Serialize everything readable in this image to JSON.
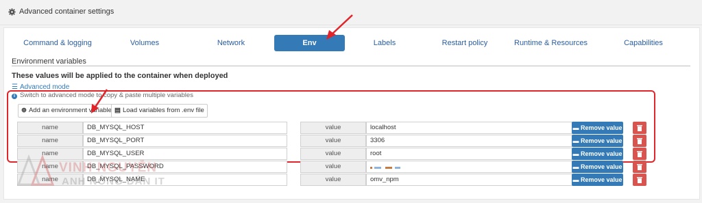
{
  "header": {
    "title": "Advanced container settings",
    "icon": "gear-icon"
  },
  "tabs": [
    {
      "label": "Command & logging",
      "active": false
    },
    {
      "label": "Volumes",
      "active": false
    },
    {
      "label": "Network",
      "active": false
    },
    {
      "label": "Env",
      "active": true
    },
    {
      "label": "Labels",
      "active": false
    },
    {
      "label": "Restart policy",
      "active": false
    },
    {
      "label": "Runtime & Resources",
      "active": false
    },
    {
      "label": "Capabilities",
      "active": false
    }
  ],
  "env": {
    "section_title": "Environment variables",
    "applied_text": "These values will be applied to the container when deployed",
    "advanced_mode_label": "Advanced mode",
    "hint": "Switch to advanced mode to copy & paste multiple variables",
    "add_button": "Add an environment variable",
    "load_button": "Load variables from .env file",
    "name_label": "name",
    "value_label": "value",
    "remove_label": "Remove value",
    "variables": [
      {
        "name": "DB_MYSQL_HOST",
        "value": "localhost"
      },
      {
        "name": "DB_MYSQL_PORT",
        "value": "3306"
      },
      {
        "name": "DB_MYSQL_USER",
        "value": "root"
      },
      {
        "name": "DB_MYSQL_PASSWORD",
        "value": ""
      },
      {
        "name": "DB_MYSQL_NAME",
        "value": "omv_npm"
      }
    ]
  },
  "watermark": {
    "line1": "VINH NGUYỄN",
    "line2": "ANH NÔNG DÂN IT"
  },
  "colors": {
    "accent": "#337ab7",
    "danger": "#d9534f",
    "highlight": "#e0242a"
  }
}
